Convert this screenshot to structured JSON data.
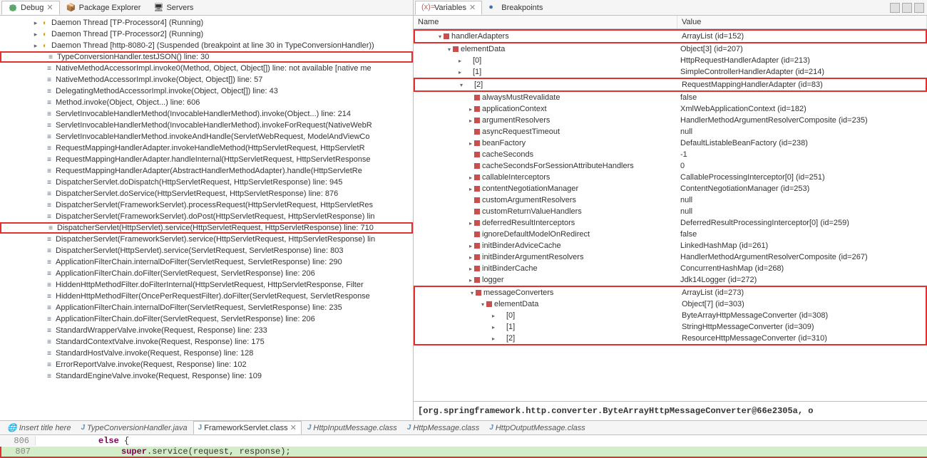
{
  "debug_tabs": {
    "debug": "Debug",
    "pkg_explorer": "Package Explorer",
    "servers": "Servers"
  },
  "threads": [
    {
      "indent": 40,
      "icon": "thread",
      "label": "Daemon Thread [TP-Processor4] (Running)"
    },
    {
      "indent": 40,
      "icon": "thread",
      "label": "Daemon Thread [TP-Processor2] (Running)"
    },
    {
      "indent": 40,
      "icon": "thread-sus",
      "label": "Daemon Thread [http-8080-2] (Suspended (breakpoint at line 30 in TypeConversionHandler))"
    }
  ],
  "stack": [
    {
      "label": "TypeConversionHandler.testJSON() line: 30",
      "hl": true
    },
    {
      "label": "NativeMethodAccessorImpl.invoke0(Method, Object, Object[]) line: not available [native me"
    },
    {
      "label": "NativeMethodAccessorImpl.invoke(Object, Object[]) line: 57"
    },
    {
      "label": "DelegatingMethodAccessorImpl.invoke(Object, Object[]) line: 43"
    },
    {
      "label": "Method.invoke(Object, Object...) line: 606"
    },
    {
      "label": "ServletInvocableHandlerMethod(InvocableHandlerMethod).invoke(Object...) line: 214"
    },
    {
      "label": "ServletInvocableHandlerMethod(InvocableHandlerMethod).invokeForRequest(NativeWebR"
    },
    {
      "label": "ServletInvocableHandlerMethod.invokeAndHandle(ServletWebRequest, ModelAndViewCo"
    },
    {
      "label": "RequestMappingHandlerAdapter.invokeHandleMethod(HttpServletRequest, HttpServletR"
    },
    {
      "label": "RequestMappingHandlerAdapter.handleInternal(HttpServletRequest, HttpServletResponse"
    },
    {
      "label": "RequestMappingHandlerAdapter(AbstractHandlerMethodAdapter).handle(HttpServletRe"
    },
    {
      "label": "DispatcherServlet.doDispatch(HttpServletRequest, HttpServletResponse) line: 945"
    },
    {
      "label": "DispatcherServlet.doService(HttpServletRequest, HttpServletResponse) line: 876"
    },
    {
      "label": "DispatcherServlet(FrameworkServlet).processRequest(HttpServletRequest, HttpServletRes"
    },
    {
      "label": "DispatcherServlet(FrameworkServlet).doPost(HttpServletRequest, HttpServletResponse) lin"
    },
    {
      "label": "DispatcherServlet(HttpServlet).service(HttpServletRequest, HttpServletResponse) line: 710",
      "hl": true
    },
    {
      "label": "DispatcherServlet(FrameworkServlet).service(HttpServletRequest, HttpServletResponse) lin"
    },
    {
      "label": "DispatcherServlet(HttpServlet).service(ServletRequest, ServletResponse) line: 803"
    },
    {
      "label": "ApplicationFilterChain.internalDoFilter(ServletRequest, ServletResponse) line: 290"
    },
    {
      "label": "ApplicationFilterChain.doFilter(ServletRequest, ServletResponse) line: 206"
    },
    {
      "label": "HiddenHttpMethodFilter.doFilterInternal(HttpServletRequest, HttpServletResponse, Filter"
    },
    {
      "label": "HiddenHttpMethodFilter(OncePerRequestFilter).doFilter(ServletRequest, ServletResponse"
    },
    {
      "label": "ApplicationFilterChain.internalDoFilter(ServletRequest, ServletResponse) line: 235"
    },
    {
      "label": "ApplicationFilterChain.doFilter(ServletRequest, ServletResponse) line: 206"
    },
    {
      "label": "StandardWrapperValve.invoke(Request, Response) line: 233"
    },
    {
      "label": "StandardContextValve.invoke(Request, Response) line: 175"
    },
    {
      "label": "StandardHostValve.invoke(Request, Response) line: 128"
    },
    {
      "label": "ErrorReportValve.invoke(Request, Response) line: 102"
    },
    {
      "label": "StandardEngineValve.invoke(Request, Response) line: 109"
    }
  ],
  "vars_tabs": {
    "variables": "Variables",
    "breakpoints": "Breakpoints"
  },
  "vars_header": {
    "name": "Name",
    "value": "Value"
  },
  "vars": [
    {
      "indent": 30,
      "tw": "▾",
      "ico": "red",
      "name": "handlerAdapters",
      "value": "ArrayList<E>  (id=152)",
      "hl": true
    },
    {
      "indent": 45,
      "tw": "▾",
      "ico": "red",
      "name": "elementData",
      "value": "Object[3]  (id=207)"
    },
    {
      "indent": 60,
      "tw": "▸",
      "ico": "tri",
      "name": "[0]",
      "value": "HttpRequestHandlerAdapter  (id=213)"
    },
    {
      "indent": 60,
      "tw": "▸",
      "ico": "tri",
      "name": "[1]",
      "value": "SimpleControllerHandlerAdapter  (id=214)"
    },
    {
      "indent": 60,
      "tw": "▾",
      "ico": "tri",
      "name": "[2]",
      "value": "RequestMappingHandlerAdapter  (id=83)",
      "hl": true
    },
    {
      "indent": 75,
      "tw": "",
      "ico": "red",
      "name": "alwaysMustRevalidate",
      "value": "false"
    },
    {
      "indent": 75,
      "tw": "▸",
      "ico": "red",
      "name": "applicationContext",
      "value": "XmlWebApplicationContext  (id=182)"
    },
    {
      "indent": 75,
      "tw": "▸",
      "ico": "red",
      "name": "argumentResolvers",
      "value": "HandlerMethodArgumentResolverComposite  (id=235)"
    },
    {
      "indent": 75,
      "tw": "",
      "ico": "red",
      "name": "asyncRequestTimeout",
      "value": "null"
    },
    {
      "indent": 75,
      "tw": "▸",
      "ico": "red",
      "name": "beanFactory",
      "value": "DefaultListableBeanFactory  (id=238)"
    },
    {
      "indent": 75,
      "tw": "",
      "ico": "red",
      "name": "cacheSeconds",
      "value": "-1"
    },
    {
      "indent": 75,
      "tw": "",
      "ico": "red",
      "name": "cacheSecondsForSessionAttributeHandlers",
      "value": "0"
    },
    {
      "indent": 75,
      "tw": "▸",
      "ico": "red",
      "name": "callableInterceptors",
      "value": "CallableProcessingInterceptor[0]  (id=251)"
    },
    {
      "indent": 75,
      "tw": "▸",
      "ico": "red",
      "name": "contentNegotiationManager",
      "value": "ContentNegotiationManager  (id=253)"
    },
    {
      "indent": 75,
      "tw": "",
      "ico": "red",
      "name": "customArgumentResolvers",
      "value": "null"
    },
    {
      "indent": 75,
      "tw": "",
      "ico": "red",
      "name": "customReturnValueHandlers",
      "value": "null"
    },
    {
      "indent": 75,
      "tw": "▸",
      "ico": "red",
      "name": "deferredResultInterceptors",
      "value": "DeferredResultProcessingInterceptor[0]  (id=259)"
    },
    {
      "indent": 75,
      "tw": "",
      "ico": "red",
      "name": "ignoreDefaultModelOnRedirect",
      "value": "false"
    },
    {
      "indent": 75,
      "tw": "▸",
      "ico": "red",
      "name": "initBinderAdviceCache",
      "value": "LinkedHashMap<K,V>  (id=261)"
    },
    {
      "indent": 75,
      "tw": "▸",
      "ico": "red",
      "name": "initBinderArgumentResolvers",
      "value": "HandlerMethodArgumentResolverComposite  (id=267)"
    },
    {
      "indent": 75,
      "tw": "▸",
      "ico": "red",
      "name": "initBinderCache",
      "value": "ConcurrentHashMap<K,V>  (id=268)"
    },
    {
      "indent": 75,
      "tw": "▸",
      "ico": "red",
      "name": "logger",
      "value": "Jdk14Logger  (id=272)"
    },
    {
      "indent": 75,
      "tw": "▾",
      "ico": "red",
      "name": "messageConverters",
      "value": "ArrayList<E>  (id=273)",
      "hl": true
    },
    {
      "indent": 90,
      "tw": "▾",
      "ico": "red",
      "name": "elementData",
      "value": "Object[7]  (id=303)",
      "hl": true
    },
    {
      "indent": 105,
      "tw": "▸",
      "ico": "tri",
      "name": "[0]",
      "value": "ByteArrayHttpMessageConverter  (id=308)",
      "hl": true
    },
    {
      "indent": 105,
      "tw": "▸",
      "ico": "tri",
      "name": "[1]",
      "value": "StringHttpMessageConverter  (id=309)",
      "hl": true
    },
    {
      "indent": 105,
      "tw": "▸",
      "ico": "tri",
      "name": "[2]",
      "value": "ResourceHttpMessageConverter  (id=310)",
      "hl": true
    }
  ],
  "preview": "[org.springframework.http.converter.ByteArrayHttpMessageConverter@66e2305a, o",
  "editor_tabs": [
    {
      "label": "Insert title here",
      "icon": "web"
    },
    {
      "label": "TypeConversionHandler.java",
      "icon": "j"
    },
    {
      "label": "FrameworkServlet.class",
      "icon": "j",
      "active": true
    },
    {
      "label": "HttpInputMessage.class",
      "icon": "j"
    },
    {
      "label": "HttpMessage.class",
      "icon": "j"
    },
    {
      "label": "HttpOutputMessage.class",
      "icon": "j"
    }
  ],
  "code": {
    "line806_num": "806",
    "line806_kw": "else",
    "line806_rest": " {",
    "line807_num": "807",
    "line807_kw": "super",
    "line807_rest": ".service(request, response);"
  }
}
